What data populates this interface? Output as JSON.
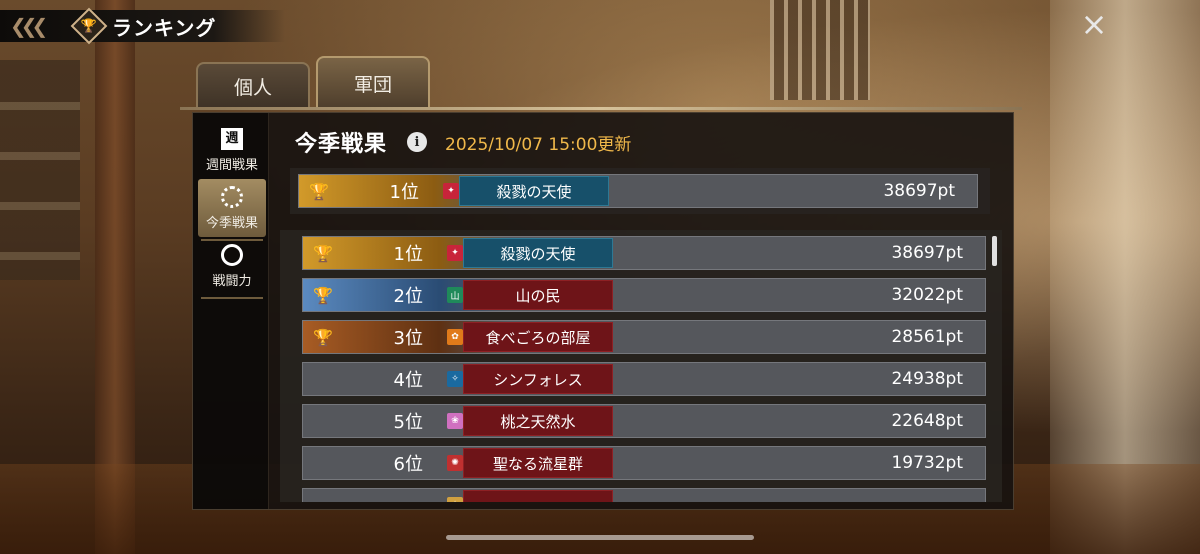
{
  "header": {
    "title": "ランキング",
    "close_icon": "×"
  },
  "tabs": [
    {
      "label": "個人",
      "active": false
    },
    {
      "label": "軍団",
      "active": true
    }
  ],
  "side_nav": [
    {
      "label": "週間戦果",
      "icon": "週",
      "icon_name": "week-icon",
      "active": false
    },
    {
      "label": "今季戦果",
      "icon_name": "dots-circle-icon",
      "active": true
    },
    {
      "label": "戦闘力",
      "icon_name": "ring-icon",
      "active": false
    }
  ],
  "season": {
    "title": "今季戦果",
    "info_icon": "i",
    "updated": "2025/10/07  15:00更新"
  },
  "my_rank": {
    "rank": "1位",
    "name": "殺戮の天使",
    "score": "38697pt",
    "medal": "gold",
    "flag_color": "#c8243a"
  },
  "rankings": [
    {
      "rank": "1位",
      "name": "殺戮の天使",
      "score": "38697pt",
      "medal": "gold",
      "name_style": "blue",
      "flag_color": "#c8243a"
    },
    {
      "rank": "2位",
      "name": "山の民",
      "score": "32022pt",
      "medal": "silver",
      "name_style": "red",
      "flag_color": "#1f8a5a"
    },
    {
      "rank": "3位",
      "name": "食べごろの部屋",
      "score": "28561pt",
      "medal": "bronze",
      "name_style": "red",
      "flag_color": "#e07a1a"
    },
    {
      "rank": "4位",
      "name": "シンフォレス",
      "score": "24938pt",
      "medal": "none",
      "name_style": "red",
      "flag_color": "#1a6aa0"
    },
    {
      "rank": "5位",
      "name": "桃之天然水",
      "score": "22648pt",
      "medal": "none",
      "name_style": "red",
      "flag_color": "#d070c0"
    },
    {
      "rank": "6位",
      "name": "聖なる流星群",
      "score": "19732pt",
      "medal": "none",
      "name_style": "red",
      "flag_color": "#c03030"
    }
  ],
  "colors": {
    "accent_orange": "#f0b84a",
    "blue_name": "#17506a",
    "red_name": "#6e1418"
  }
}
